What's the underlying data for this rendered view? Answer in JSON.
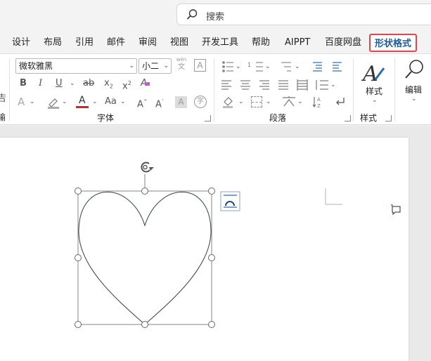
{
  "search": {
    "placeholder": "搜索",
    "icon": "search-icon"
  },
  "tabs": [
    {
      "label": "设计"
    },
    {
      "label": "布局"
    },
    {
      "label": "引用"
    },
    {
      "label": "邮件"
    },
    {
      "label": "审阅"
    },
    {
      "label": "视图"
    },
    {
      "label": "开发工具"
    },
    {
      "label": "帮助"
    },
    {
      "label": "AIPPT"
    },
    {
      "label": "百度网盘"
    },
    {
      "label": "形状格式",
      "active": true
    }
  ],
  "font": {
    "name": "微软雅黑",
    "size": "小二",
    "phonetic_top": "wén",
    "phonetic_bottom": "文",
    "group_label": "字体"
  },
  "paragraph": {
    "group_label": "段落"
  },
  "styles": {
    "button_label": "样式",
    "group_label": "样式"
  },
  "editing": {
    "button_label": "编辑"
  },
  "left_partial": {
    "top_char": "吉",
    "bottom_char": "输"
  },
  "colors": {
    "accent_tab": "#e0464e",
    "font_color": "#e02020",
    "highlight": "#f0c800"
  }
}
